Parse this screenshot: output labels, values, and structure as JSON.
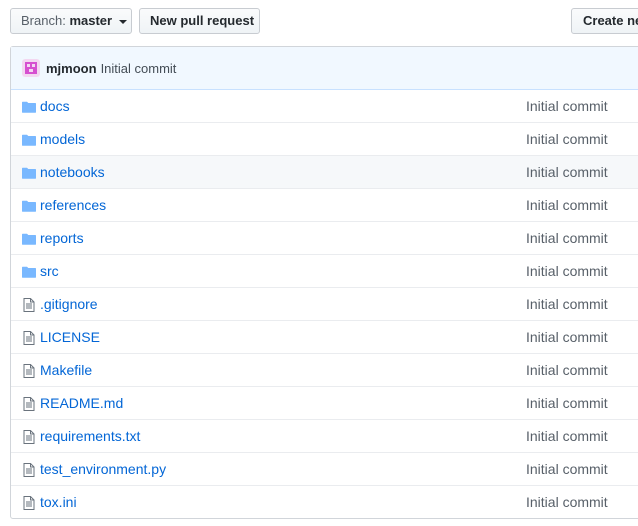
{
  "toolbar": {
    "branch_prefix": "Branch:",
    "branch_name": "master",
    "new_pr_label": "New pull request",
    "create_label": "Create ne"
  },
  "latest_commit": {
    "author": "mjmoon",
    "message": "Initial commit"
  },
  "files": [
    {
      "name": "docs",
      "type": "folder",
      "message": "Initial commit"
    },
    {
      "name": "models",
      "type": "folder",
      "message": "Initial commit"
    },
    {
      "name": "notebooks",
      "type": "folder",
      "message": "Initial commit"
    },
    {
      "name": "references",
      "type": "folder",
      "message": "Initial commit"
    },
    {
      "name": "reports",
      "type": "folder",
      "message": "Initial commit"
    },
    {
      "name": "src",
      "type": "folder",
      "message": "Initial commit"
    },
    {
      "name": ".gitignore",
      "type": "file",
      "message": "Initial commit"
    },
    {
      "name": "LICENSE",
      "type": "file",
      "message": "Initial commit"
    },
    {
      "name": "Makefile",
      "type": "file",
      "message": "Initial commit"
    },
    {
      "name": "README.md",
      "type": "file",
      "message": "Initial commit"
    },
    {
      "name": "requirements.txt",
      "type": "file",
      "message": "Initial commit"
    },
    {
      "name": "test_environment.py",
      "type": "file",
      "message": "Initial commit"
    },
    {
      "name": "tox.ini",
      "type": "file",
      "message": "Initial commit"
    }
  ],
  "icons": {
    "folder": "folder-icon",
    "file": "file-icon",
    "caret": "caret-down-icon"
  },
  "colors": {
    "link": "#0366d6",
    "folder_icon": "#79b8ff",
    "avatar": "#e14ed8"
  }
}
